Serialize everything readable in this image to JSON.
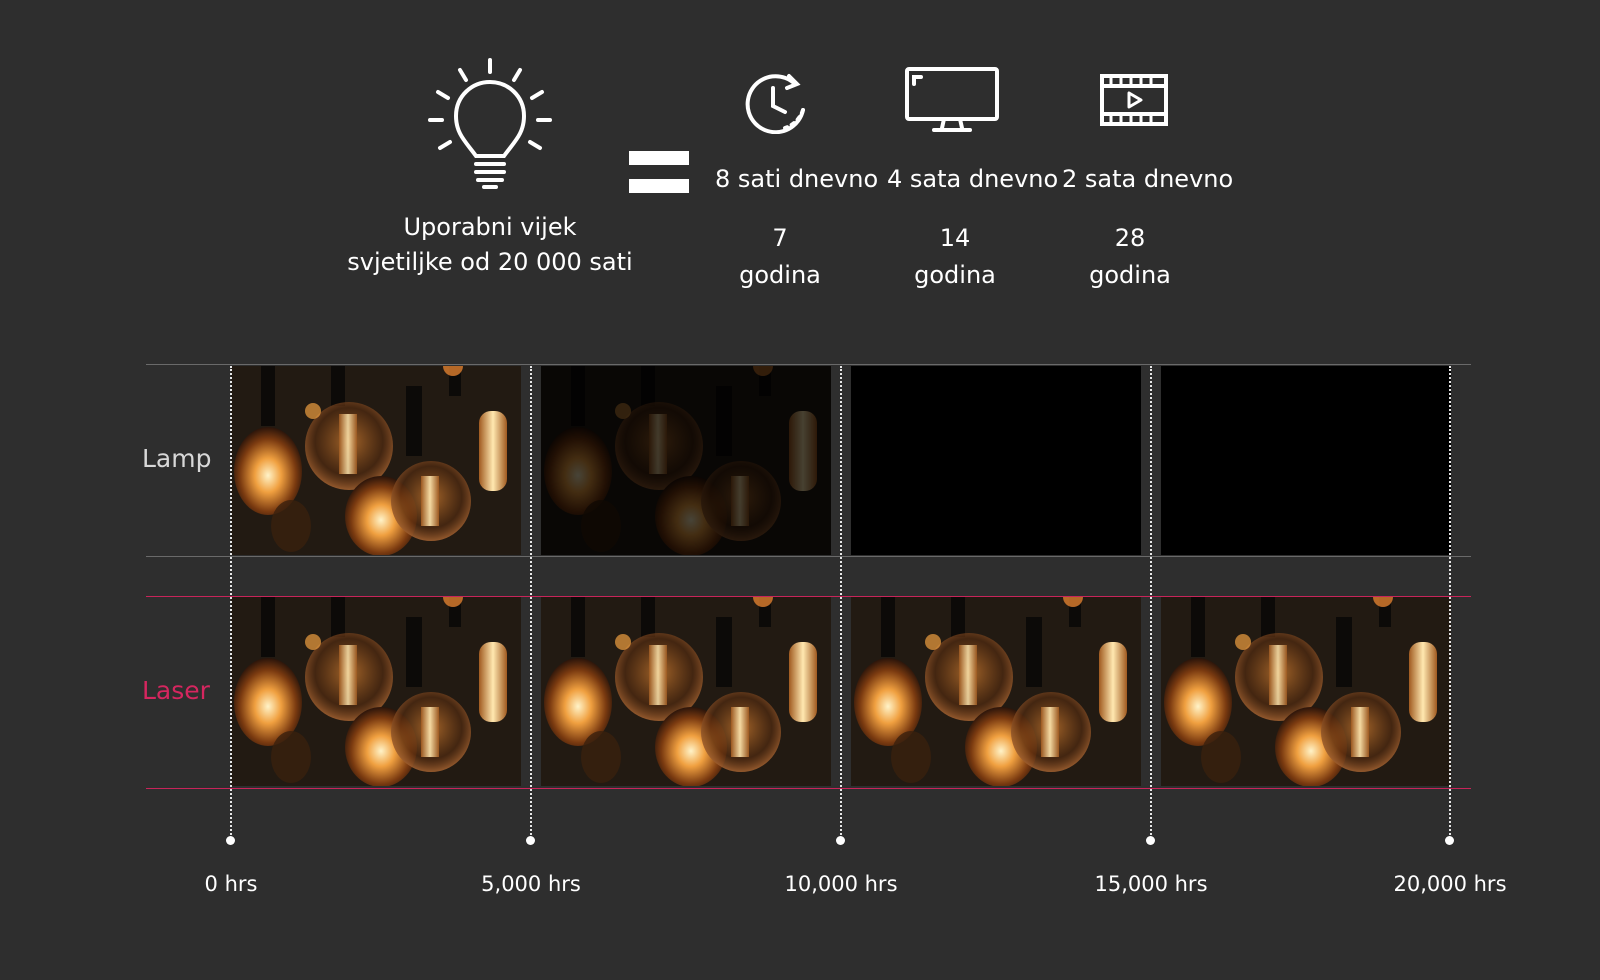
{
  "header": {
    "bulb_icon": "light-bulb-icon",
    "caption_line1": "Uporabni vijek",
    "caption_line2": "svjetiljke od 20 000 sati",
    "equals_icon": "equals-icon"
  },
  "usage": [
    {
      "icon": "clock-icon",
      "label": "8 sati dnevno",
      "years_num": "7",
      "years_word": "godina"
    },
    {
      "icon": "monitor-icon",
      "label": "4 sata dnevno",
      "years_num": "14",
      "years_word": "godina"
    },
    {
      "icon": "film-icon",
      "label": "2 sata dnevno",
      "years_num": "28",
      "years_word": "godina"
    }
  ],
  "rows": {
    "lamp_label": "Lamp",
    "laser_label": "Laser",
    "lamp_states": [
      "bright",
      "dim",
      "off",
      "off"
    ],
    "laser_states": [
      "bright",
      "bright",
      "bright",
      "bright"
    ]
  },
  "timeline": {
    "ticks": [
      "0 hrs",
      "5,000 hrs",
      "10,000 hrs",
      "15,000 hrs",
      "20,000 hrs"
    ]
  },
  "colors": {
    "background": "#2e2e2e",
    "laser_accent": "#d5265f",
    "lamp_text": "#d8d8d8"
  }
}
